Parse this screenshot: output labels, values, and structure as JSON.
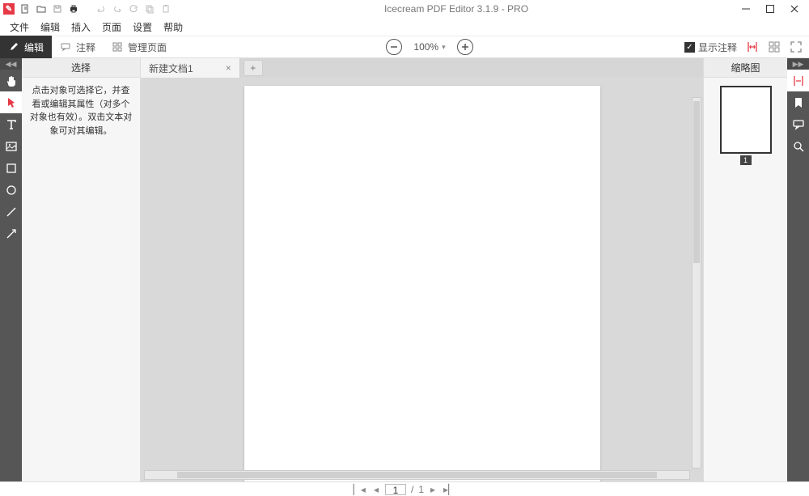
{
  "titlebar": {
    "title": "Icecream PDF Editor 3.1.9 - PRO"
  },
  "menubar": [
    "文件",
    "编辑",
    "插入",
    "页面",
    "设置",
    "帮助"
  ],
  "modes": {
    "edit": "编辑",
    "annotate": "注释",
    "manage": "管理页面"
  },
  "zoom": {
    "value": "100%"
  },
  "show_annotations": "显示注释",
  "left_panel": {
    "title": "选择",
    "desc": "点击对象可选择它，并查看或编辑其属性（对多个对象也有效）。双击文本对象可对其编辑。"
  },
  "tabs": [
    {
      "label": "新建文档1"
    }
  ],
  "right_panel": {
    "title": "缩略图"
  },
  "thumbnails": [
    {
      "num": "1"
    }
  ],
  "pagenav": {
    "current": "1",
    "total": "1",
    "sep": "/"
  }
}
